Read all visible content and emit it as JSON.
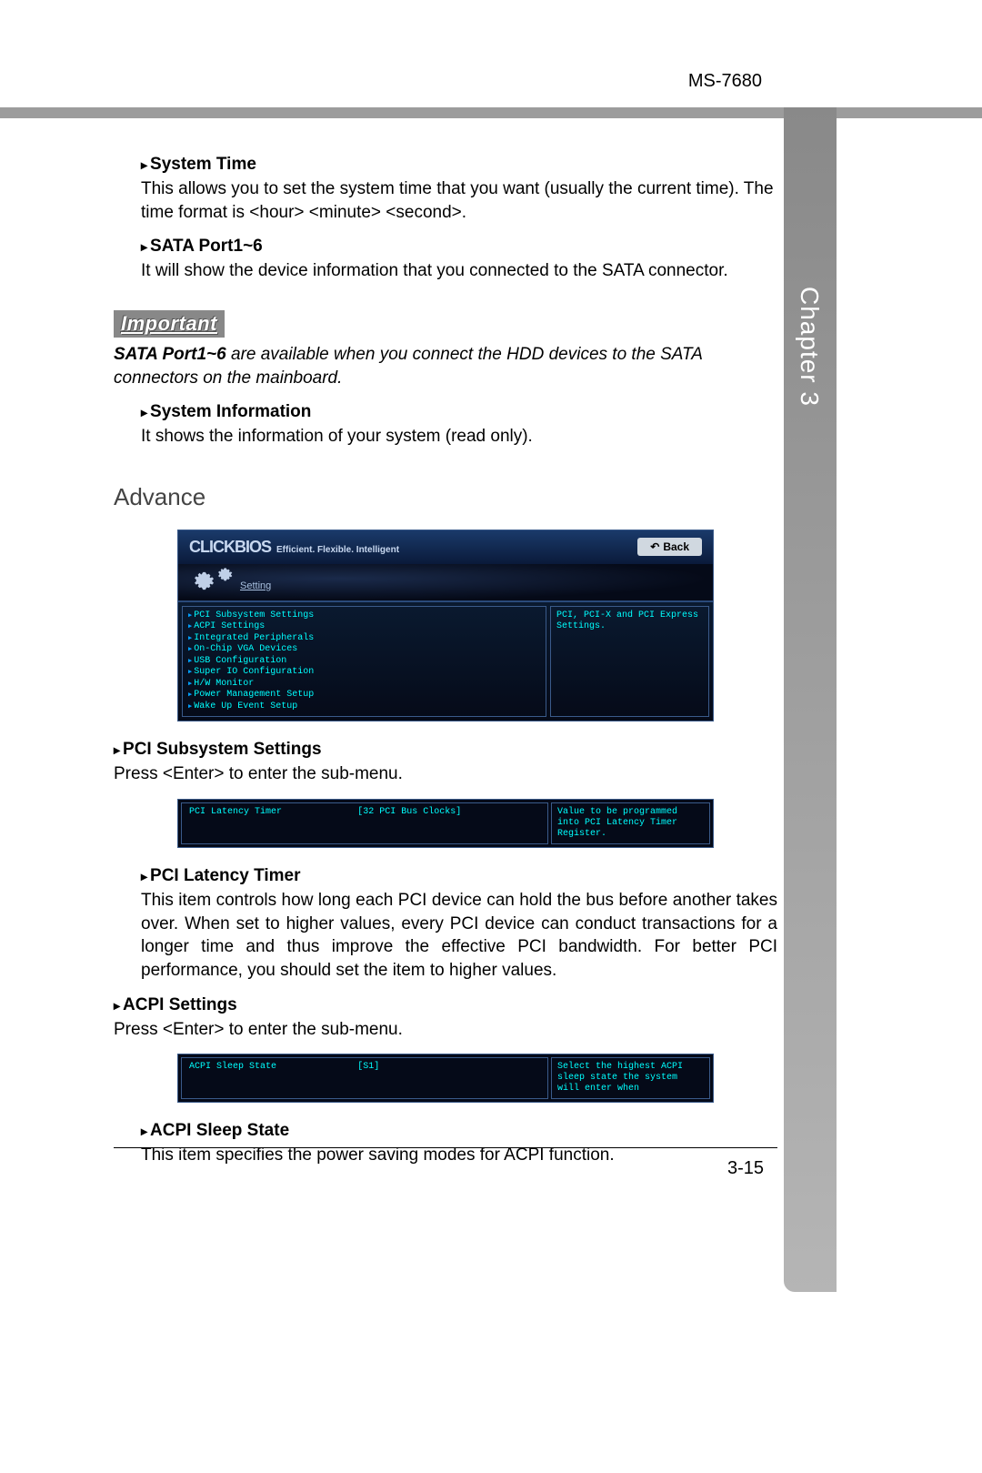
{
  "doc_id": "MS-7680",
  "side_tab": "Chapter 3",
  "sections": {
    "system_time": {
      "title": "System Time",
      "body": "This allows you to set the system time that you want (usually the current time). The time format is <hour> <minute> <second>."
    },
    "sata": {
      "title": "SATA Port1~6",
      "body": "It will show the device information that you connected to the SATA connector."
    },
    "important_label": "Important",
    "important_note_bold": "SATA Port1~6",
    "important_note_rest": " are available when you connect the HDD devices to the SATA connectors on the mainboard.",
    "sysinfo": {
      "title": "System Information",
      "body": "It shows the information of your system (read only)."
    },
    "advance_heading": "Advance",
    "pci_sub": {
      "title": "PCI Subsystem Settings",
      "body": "Press <Enter> to enter the sub-menu."
    },
    "pci_lat": {
      "title": "PCI Latency Timer",
      "body": "This item controls how long each PCI device can hold the bus before another takes over. When set to higher values, every PCI device can conduct transactions for a longer time and thus improve the effective PCI bandwidth. For better PCI performance, you should set the item to higher values."
    },
    "acpi": {
      "title": "ACPI Settings",
      "body": "Press <Enter> to enter the sub-menu."
    },
    "acpi_sleep": {
      "title": "ACPI Sleep State",
      "body": "This item specifies the power saving modes for ACPI function."
    }
  },
  "bios_main": {
    "brand": "CLICKBIOS",
    "tagline": "Efficient. Flexible. Intelligent",
    "back": "Back",
    "setting_tab": "Setting",
    "menu": [
      "PCI Subsystem Settings",
      "ACPI Settings",
      "Integrated Peripherals",
      "On-Chip VGA Devices",
      "USB Configuration",
      "Super IO Configuration",
      "H/W Monitor",
      "Power Management Setup",
      "Wake Up Event Setup"
    ],
    "help": "PCI, PCI-X and PCI Express Settings."
  },
  "bios_strip1": {
    "label": "PCI Latency Timer",
    "value": "[32 PCI Bus Clocks]",
    "help": "Value to be programmed into PCI Latency Timer Register."
  },
  "bios_strip2": {
    "label": "ACPI Sleep State",
    "value": "[S1]",
    "help": "Select the highest ACPI sleep state the system will enter when"
  },
  "page_num": "3-15"
}
